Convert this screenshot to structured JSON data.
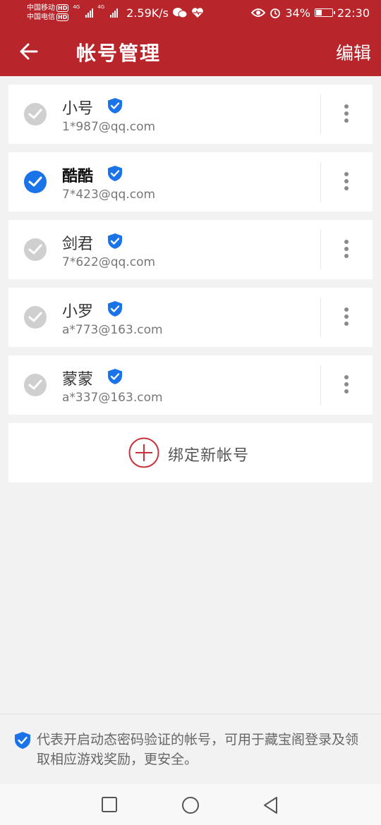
{
  "status": {
    "carrier1": "中国移动",
    "carrier2": "中国电信",
    "hd": "HD",
    "net1": "4G",
    "net2": "4G",
    "speed": "2.59K/s",
    "battery": "34%",
    "time": "22:30",
    "battery_level": 0.34
  },
  "header": {
    "title": "帐号管理",
    "edit_label": "编辑"
  },
  "accounts": [
    {
      "name": "小号",
      "email": "1*987@qq.com",
      "selected": false
    },
    {
      "name": "酷酷",
      "email": "7*423@qq.com",
      "selected": true
    },
    {
      "name": "剑君",
      "email": "7*622@qq.com",
      "selected": false
    },
    {
      "name": "小罗",
      "email": "a*773@163.com",
      "selected": false
    },
    {
      "name": "蒙蒙",
      "email": "a*337@163.com",
      "selected": false
    }
  ],
  "add_account_label": "绑定新帐号",
  "note": "代表开启动态密码验证的帐号，可用于藏宝阁登录及领取相应游戏奖励，更安全。",
  "colors": {
    "brand": "#b8262b",
    "accent": "#1a73e8",
    "check_off": "#cfcfcf"
  },
  "icons": [
    "back-arrow-icon",
    "verified-shield-icon",
    "checkmark-icon",
    "more-vertical-icon",
    "plus-circle-icon",
    "square-nav-icon",
    "circle-nav-icon",
    "triangle-back-nav-icon"
  ]
}
